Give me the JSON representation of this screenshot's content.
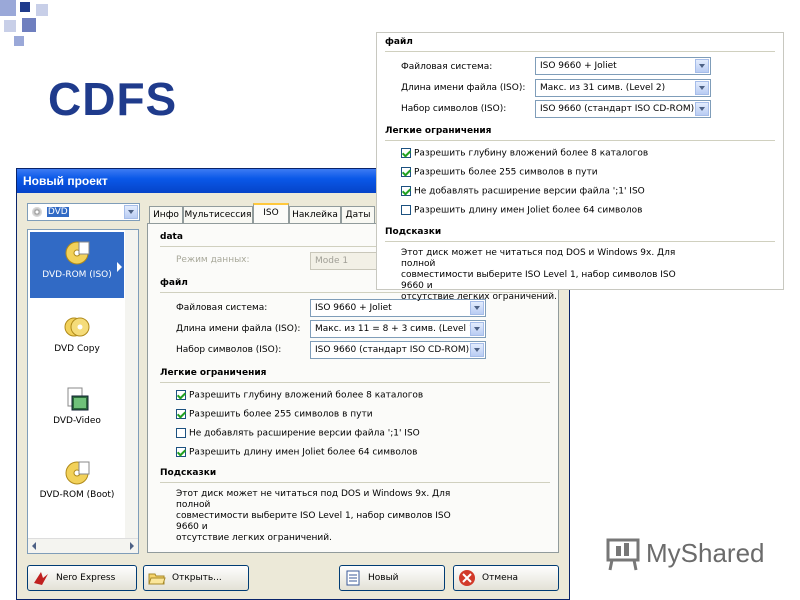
{
  "slide": {
    "title": "CDFS",
    "logo_text": "MyShared"
  },
  "window": {
    "title": "Новый проект",
    "type_combo": "DVD",
    "projects": [
      {
        "label": "DVD-ROM (ISO)",
        "icon": "dvd-disc-icon"
      },
      {
        "label": "DVD Copy",
        "icon": "dvd-copy-icon"
      },
      {
        "label": "DVD-Video",
        "icon": "dvd-video-icon"
      },
      {
        "label": "DVD-ROM (Boot)",
        "icon": "dvd-boot-icon"
      }
    ],
    "tabs": [
      "Инфо",
      "Мультисессия",
      "ISO",
      "Наклейка",
      "Даты"
    ],
    "active_tab": "ISO",
    "data_section": {
      "title": "data",
      "mode_label": "Режим данных:",
      "mode_value": "Mode 1"
    },
    "file_section": {
      "title": "файл",
      "fs_label": "Файловая система:",
      "fs_value": "ISO 9660 + Joliet",
      "len_label": "Длина имени файла (ISO):",
      "len_value": "Макс. из 11 = 8 + 3 симв. (Level 1)",
      "charset_label": "Набор символов (ISO):",
      "charset_value": "ISO 9660 (стандарт ISO CD-ROM)"
    },
    "relax_section": {
      "title": "Легкие ограничения",
      "options": [
        {
          "label": "Разрешить глубину вложений более 8 каталогов",
          "checked": true
        },
        {
          "label": "Разрешить более 255 символов в пути",
          "checked": true
        },
        {
          "label": "Не добавлять расширение версии файла ';1' ISO",
          "checked": false
        },
        {
          "label": "Разрешить длину имен Joliet более 64 символов",
          "checked": true
        }
      ]
    },
    "hints_section": {
      "title": "Подсказки",
      "lines": [
        "Этот диск может не читаться под DOS и Windows 9x. Для полной",
        "совместимости выберите ISO Level 1, набор символов ISO 9660 и",
        "отсутствие легких ограничений."
      ]
    },
    "buttons": {
      "nero_express": "Nero Express",
      "open": "Открыть...",
      "new": "Новый",
      "cancel": "Отмена"
    }
  },
  "zoom": {
    "file_title": "файл",
    "fs_label": "Файловая система:",
    "fs_value": "ISO 9660 + Joliet",
    "len_label": "Длина имени файла (ISO):",
    "len_value": "Макс. из 31 симв. (Level 2)",
    "charset_label": "Набор символов (ISO):",
    "charset_value": "ISO 9660 (стандарт ISO CD-ROM)",
    "relax_title": "Легкие ограничения",
    "options": [
      {
        "label": "Разрешить глубину вложений более 8 каталогов",
        "checked": true
      },
      {
        "label": "Разрешить более 255 символов в пути",
        "checked": true
      },
      {
        "label": "Не добавлять расширение версии файла ';1' ISO",
        "checked": true
      },
      {
        "label": "Разрешить длину имен Joliet более 64 символов",
        "checked": false
      }
    ],
    "hints_title": "Подсказки",
    "hint_lines": [
      "Этот диск может не читаться под DOS и Windows 9x. Для полной",
      "совместимости выберите ISO Level 1, набор символов ISO 9660 и",
      "отсутствие легких ограничений."
    ]
  },
  "colors": {
    "title_blue": "#1f3b8c",
    "selection": "#316ac5",
    "titlebar": "#0a58e8"
  }
}
